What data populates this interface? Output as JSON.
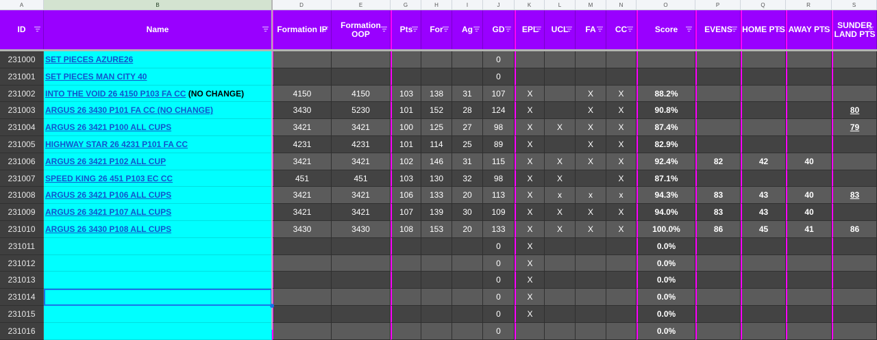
{
  "columns": [
    {
      "letter": "A",
      "w": 64
    },
    {
      "letter": "B",
      "w": 333
    },
    {
      "letter": "D",
      "w": 87
    },
    {
      "letter": "E",
      "w": 86
    },
    {
      "letter": "G",
      "w": 45
    },
    {
      "letter": "H",
      "w": 45
    },
    {
      "letter": "I",
      "w": 45
    },
    {
      "letter": "J",
      "w": 46
    },
    {
      "letter": "K",
      "w": 44
    },
    {
      "letter": "L",
      "w": 45
    },
    {
      "letter": "M",
      "w": 45
    },
    {
      "letter": "N",
      "w": 44
    },
    {
      "letter": "O",
      "w": 86
    },
    {
      "letter": "P",
      "w": 66
    },
    {
      "letter": "Q",
      "w": 66
    },
    {
      "letter": "R",
      "w": 67
    },
    {
      "letter": "S",
      "w": 66
    }
  ],
  "headers": [
    "ID",
    "Name",
    "Formation IP",
    "Formation OOP",
    "Pts",
    "For",
    "Ag",
    "GD",
    "EPL",
    "UCL",
    "FA",
    "CC",
    "Score",
    "EVENS",
    "HOME PTS",
    "AWAY PTS",
    "SUNDER LAND PTS"
  ],
  "colors": {
    "header_bg": "#9900ff",
    "name_bg": "#00ffff",
    "link": "#1155cc",
    "divider": "#ff00ff"
  },
  "rows": [
    {
      "id": "231000",
      "name": "SET PIECES AZURE26",
      "link": true,
      "cells": [
        "",
        "",
        "",
        "",
        "",
        "0",
        "",
        "",
        "",
        "",
        "",
        "",
        "",
        "",
        ""
      ],
      "u": []
    },
    {
      "id": "231001",
      "name": "SET PIECES MAN CITY 40",
      "link": true,
      "cells": [
        "",
        "",
        "",
        "",
        "",
        "0",
        "",
        "",
        "",
        "",
        "",
        "",
        "",
        "",
        ""
      ],
      "u": []
    },
    {
      "id": "231002",
      "name": "INTO THE VOID 26 4150 P103 FA CC",
      "suffix": " (NO CHANGE)",
      "link": true,
      "cells": [
        "4150",
        "4150",
        "103",
        "138",
        "31",
        "107",
        "X",
        "",
        "X",
        "X",
        "88.2%",
        "",
        "",
        "",
        ""
      ],
      "u": []
    },
    {
      "id": "231003",
      "name": "ARGUS 26 3430 P101 FA CC (NO CHANGE)",
      "link": true,
      "cells": [
        "3430",
        "5230",
        "101",
        "152",
        "28",
        "124",
        "X",
        "",
        "X",
        "X",
        "90.8%",
        "",
        "",
        "",
        "80"
      ],
      "u": [
        14
      ]
    },
    {
      "id": "231004",
      "name": "ARGUS 26 3421 P100 ALL CUPS",
      "link": true,
      "cells": [
        "3421",
        "3421",
        "100",
        "125",
        "27",
        "98",
        "X",
        "X",
        "X",
        "X",
        "87.4%",
        "",
        "",
        "",
        "79"
      ],
      "u": [
        14
      ]
    },
    {
      "id": "231005",
      "name": "HIGHWAY STAR 26 4231 P101 FA CC",
      "link": true,
      "cells": [
        "4231",
        "4231",
        "101",
        "114",
        "25",
        "89",
        "X",
        "",
        "X",
        "X",
        "82.9%",
        "",
        "",
        "",
        ""
      ],
      "u": []
    },
    {
      "id": "231006",
      "name": "ARGUS 26 3421 P102 ALL CUP",
      "link": true,
      "cells": [
        "3421",
        "3421",
        "102",
        "146",
        "31",
        "115",
        "X",
        "X",
        "X",
        "X",
        "92.4%",
        "82",
        "42",
        "40",
        ""
      ],
      "u": []
    },
    {
      "id": "231007",
      "name": "SPEED KING 26 451 P103 EC CC",
      "link": true,
      "cells": [
        "451",
        "451",
        "103",
        "130",
        "32",
        "98",
        "X",
        "X",
        "",
        "X",
        "87.1%",
        "",
        "",
        "",
        ""
      ],
      "u": []
    },
    {
      "id": "231008",
      "name": "ARGUS 26 3421 P106 ALL CUPS",
      "link": true,
      "cells": [
        "3421",
        "3421",
        "106",
        "133",
        "20",
        "113",
        "X",
        "x",
        "x",
        "x",
        "94.3%",
        "83",
        "43",
        "40",
        "83"
      ],
      "u": [
        14
      ]
    },
    {
      "id": "231009",
      "name": "ARGUS 26 3421 P107 ALL CUPS",
      "link": true,
      "cells": [
        "3421",
        "3421",
        "107",
        "139",
        "30",
        "109",
        "X",
        "X",
        "X",
        "X",
        "94.0%",
        "83",
        "43",
        "40",
        ""
      ],
      "u": []
    },
    {
      "id": "231010",
      "name": "ARGUS 26 3430 P108 ALL CUPS",
      "link": true,
      "cells": [
        "3430",
        "3430",
        "108",
        "153",
        "20",
        "133",
        "X",
        "X",
        "X",
        "X",
        "100.0%",
        "86",
        "45",
        "41",
        "86"
      ],
      "u": []
    },
    {
      "id": "231011",
      "name": "",
      "link": false,
      "cells": [
        "",
        "",
        "",
        "",
        "",
        "0",
        "X",
        "",
        "",
        "",
        "0.0%",
        "",
        "",
        "",
        ""
      ],
      "u": []
    },
    {
      "id": "231012",
      "name": "",
      "link": false,
      "cells": [
        "",
        "",
        "",
        "",
        "",
        "0",
        "X",
        "",
        "",
        "",
        "0.0%",
        "",
        "",
        "",
        ""
      ],
      "u": []
    },
    {
      "id": "231013",
      "name": "",
      "link": false,
      "cells": [
        "",
        "",
        "",
        "",
        "",
        "0",
        "X",
        "",
        "",
        "",
        "0.0%",
        "",
        "",
        "",
        ""
      ],
      "u": []
    },
    {
      "id": "231014",
      "name": "",
      "link": false,
      "cells": [
        "",
        "",
        "",
        "",
        "",
        "0",
        "X",
        "",
        "",
        "",
        "0.0%",
        "",
        "",
        "",
        ""
      ],
      "u": []
    },
    {
      "id": "231015",
      "name": "",
      "link": false,
      "cells": [
        "",
        "",
        "",
        "",
        "",
        "0",
        "X",
        "",
        "",
        "",
        "0.0%",
        "",
        "",
        "",
        ""
      ],
      "u": []
    },
    {
      "id": "231016",
      "name": "",
      "link": false,
      "cells": [
        "",
        "",
        "",
        "",
        "",
        "0",
        "",
        "",
        "",
        "",
        "0.0%",
        "",
        "",
        "",
        ""
      ],
      "u": []
    }
  ]
}
